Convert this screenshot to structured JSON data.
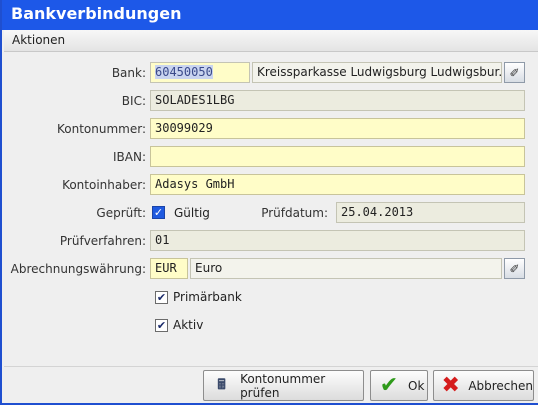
{
  "window": {
    "title": "Bankverbindungen"
  },
  "menu": {
    "items": [
      "Aktionen"
    ]
  },
  "form": {
    "bank_label": "Bank:",
    "bank_code": "60450050",
    "bank_name": "Kreissparkasse Ludwigsburg Ludwigsbur...",
    "bic_label": "BIC:",
    "bic": "SOLADES1LBG",
    "kontonummer_label": "Kontonummer:",
    "kontonummer": "30099029",
    "iban_label": "IBAN:",
    "iban": "",
    "kontoinhaber_label": "Kontoinhaber:",
    "kontoinhaber": "Adasys GmbH",
    "geprueft_label": "Geprüft:",
    "gueltig_label": "Gültig",
    "gueltig_checked": true,
    "pruefdatum_label": "Prüfdatum:",
    "pruefdatum": "25.04.2013",
    "pruefverfahren_label": "Prüfverfahren:",
    "pruefverfahren": "01",
    "waehrung_label": "Abrechnungswährung:",
    "waehrung_code": "EUR",
    "waehrung_name": "Euro",
    "primaerbank_label": "Primärbank",
    "primaerbank_checked": true,
    "aktiv_label": "Aktiv",
    "aktiv_checked": true
  },
  "icons": {
    "pick_bank": "picker-icon",
    "pick_currency": "picker-icon",
    "check_account": "calculator-icon",
    "ok": "checkmark-icon",
    "cancel": "cross-icon"
  },
  "footer": {
    "check_button": "Kontonummer prüfen",
    "ok_button": "Ok",
    "cancel_button": "Abbrechen"
  },
  "colors": {
    "titlebar": "#1d58e8",
    "editable_field": "#fffdc8",
    "readonly_field": "#ececdf"
  }
}
